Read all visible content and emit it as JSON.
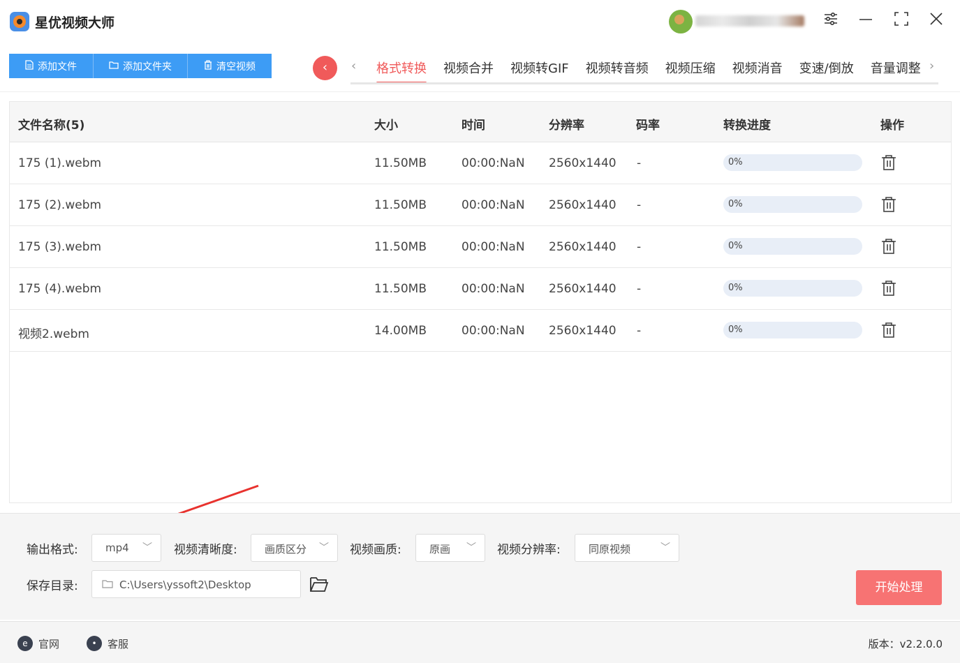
{
  "app": {
    "title": "星优视频大师"
  },
  "toolbar": {
    "add_file": "添加文件",
    "add_folder": "添加文件夹",
    "clear_videos": "清空视频"
  },
  "tabs": [
    {
      "label": "格式转换",
      "active": true
    },
    {
      "label": "视频合并"
    },
    {
      "label": "视频转GIF"
    },
    {
      "label": "视频转音频"
    },
    {
      "label": "视频压缩"
    },
    {
      "label": "视频消音"
    },
    {
      "label": "变速/倒放"
    },
    {
      "label": "音量调整"
    }
  ],
  "table": {
    "headers": {
      "name": "文件名称(5)",
      "size": "大小",
      "time": "时间",
      "resolution": "分辨率",
      "bitrate": "码率",
      "progress": "转换进度",
      "action": "操作"
    },
    "rows": [
      {
        "name": "175 (1).webm",
        "size": "11.50MB",
        "time": "00:00:NaN",
        "resolution": "2560x1440",
        "bitrate": "-",
        "progress": "0%",
        "progress_value": 0
      },
      {
        "name": "175 (2).webm",
        "size": "11.50MB",
        "time": "00:00:NaN",
        "resolution": "2560x1440",
        "bitrate": "-",
        "progress": "0%",
        "progress_value": 0
      },
      {
        "name": "175 (3).webm",
        "size": "11.50MB",
        "time": "00:00:NaN",
        "resolution": "2560x1440",
        "bitrate": "-",
        "progress": "0%",
        "progress_value": 0
      },
      {
        "name": "175 (4).webm",
        "size": "11.50MB",
        "time": "00:00:NaN",
        "resolution": "2560x1440",
        "bitrate": "-",
        "progress": "0%",
        "progress_value": 0
      },
      {
        "name": "视频2.webm",
        "size": "14.00MB",
        "time": "00:00:NaN",
        "resolution": "2560x1440",
        "bitrate": "-",
        "progress": "0%",
        "progress_value": 0
      }
    ]
  },
  "settings": {
    "output_format_label": "输出格式:",
    "output_format": "mp4",
    "clarity_label": "视频清晰度:",
    "clarity": "画质区分",
    "quality_label": "视频画质:",
    "quality": "原画",
    "resolution_label": "视频分辨率:",
    "resolution": "同原视频",
    "save_dir_label": "保存目录:",
    "save_dir": "C:\\Users\\yssoft2\\Desktop",
    "start_button": "开始处理"
  },
  "footer": {
    "website": "官网",
    "support": "客服",
    "version": "版本：v2.2.0.0"
  },
  "colors": {
    "accent_blue": "#3d9cf5",
    "accent_red": "#f05a5a",
    "start_button": "#f77373",
    "annotation_arrow": "#e8322e"
  }
}
